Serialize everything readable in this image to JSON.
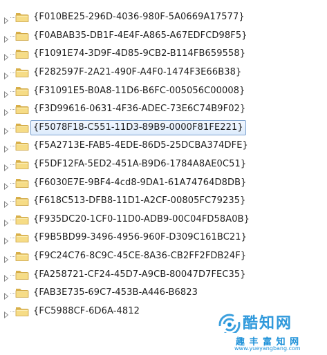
{
  "tree": {
    "items": [
      {
        "label": "{F010BE25-296D-4036-980F-5A0669A17577}",
        "selected": false
      },
      {
        "label": "{F0ABAB35-DB1F-4E4F-A865-A67EDFCD98F5}",
        "selected": false
      },
      {
        "label": "{F1091E74-3D9F-4D85-9CB2-B114FB659558}",
        "selected": false
      },
      {
        "label": "{F282597F-2A21-490F-A4F0-1474F3E66B38}",
        "selected": false
      },
      {
        "label": "{F31091E5-B0A8-11D6-B6FC-005056C00008}",
        "selected": false
      },
      {
        "label": "{F3D99616-0631-4F36-ADEC-73E6C74B9F02}",
        "selected": false
      },
      {
        "label": "{F5078F18-C551-11D3-89B9-0000F81FE221}",
        "selected": true
      },
      {
        "label": "{F5A2713E-FAB5-4EDE-86D5-25DCBA374DFE}",
        "selected": false
      },
      {
        "label": "{F5DF12FA-5ED2-451A-B9D6-1784A8AE0C51}",
        "selected": false
      },
      {
        "label": "{F6030E7E-9BF4-4cd8-9DA1-61A74764D8DB}",
        "selected": false
      },
      {
        "label": "{F618C513-DFB8-11D1-A2CF-00805FC79235}",
        "selected": false
      },
      {
        "label": "{F935DC20-1CF0-11D0-ADB9-00C04FD58A0B}",
        "selected": false
      },
      {
        "label": "{F9B5BD99-3496-4956-960F-D309C161BC21}",
        "selected": false
      },
      {
        "label": "{F9C24C76-8C9C-45CE-8A36-CB2FF2FDB24F}",
        "selected": false
      },
      {
        "label": "{FA258721-CF24-45D7-A9CB-80047D7FEC35}",
        "selected": false
      },
      {
        "label": "{FAB3E735-69C7-453B-A446-B6823",
        "selected": false
      },
      {
        "label": "{FC5988CF-6D6A-4812",
        "selected": false
      }
    ]
  },
  "watermark": {
    "title": "酷知网",
    "brand": "趣 丰 富 知 网",
    "url": "www.yueyangbang.com"
  },
  "colors": {
    "folder_light": "#f6dc86",
    "folder_dark": "#d9b04a",
    "selection_border": "#7da2ce",
    "watermark_blue": "#1a8fd8"
  },
  "icons": {
    "expander": "triangle-right-icon",
    "folder": "folder-icon"
  }
}
